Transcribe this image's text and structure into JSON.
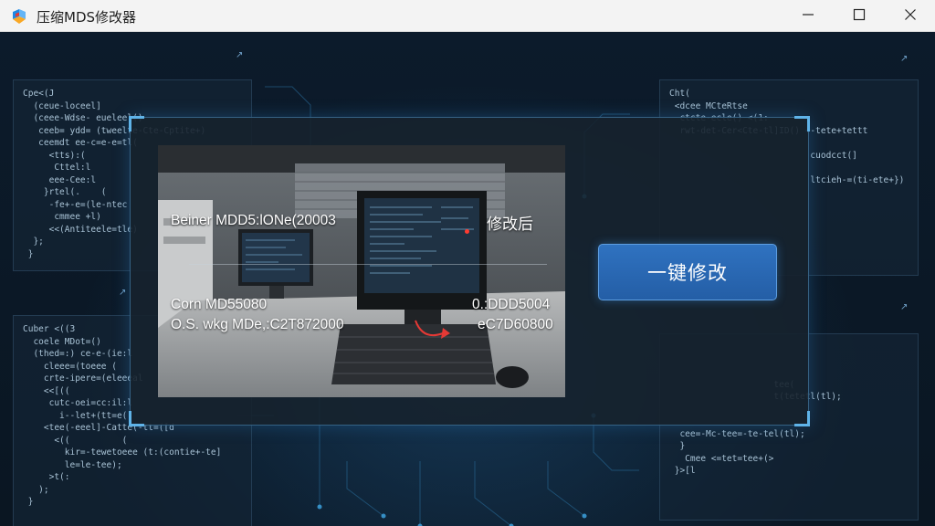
{
  "window": {
    "title": "压缩MDS修改器",
    "icon": "app-logo-icon",
    "controls": [
      "minimize-icon",
      "maximize-icon",
      "close-icon"
    ]
  },
  "dialog": {
    "before_label": "Beiner MDD5:lONe(20003",
    "after_label": "修改后",
    "original_label": "Corn MD55080",
    "os_label": "O.S. wkg MDe,:C2T872000",
    "hash_after_1": "0.:DDD5004",
    "hash_after_2": "eC7D60800",
    "action_button": "一键修改"
  },
  "code_panels": {
    "top_left": "Cpe<(J\n  (ceue-loceel]\n  (ceee-Wdse- eueleel()\n   ceeb= ydd= (tweelte-Cte-Cptite+)\n   ceemdt ee-c=e-e=tl(\n     <tts):(\n      Cttel:l\n     eee-Cee:l\n    }rtel(.    (\n     -fe+-e=(le-ntec\n      cmmee +l)\n     <<(Antiteele=tle)\n  };\n }",
    "bottom_left": "Cuber <((3\n  coele MDot=()\n  (thed=:) ce-e-(ie:l\n    cleee=(toeee (\n    crte-ipere=(eleeeal\n    <<[((\n     cutc-oei=cc:il:l\n       i--let+(tt=e((\n    <tee(-eeel]-Catte(-tt=([d\n      <((          (\n        kir=-tewetoeee (t:(contie+-te]\n        le=le-tee);\n     >t(:\n   );\n }",
    "top_right": "Cht(\n <dcee MCteRtse\n  ctcte-ecle() <(1:\n  rwt-det-Cer<Cte-tl]ID() +-tete+tettt\n\n                           cuodcct(]\n\n                           ltcieh-=(ti-ete+})",
    "bottom_right": "\n\n\n                    tee(\n                    t(tetetl(tl);\n\n\n  cee=-Mc-tee=-te-tel(tl);\n  }\n   Cmee <=tet=tee+(>\n }>[l"
  }
}
